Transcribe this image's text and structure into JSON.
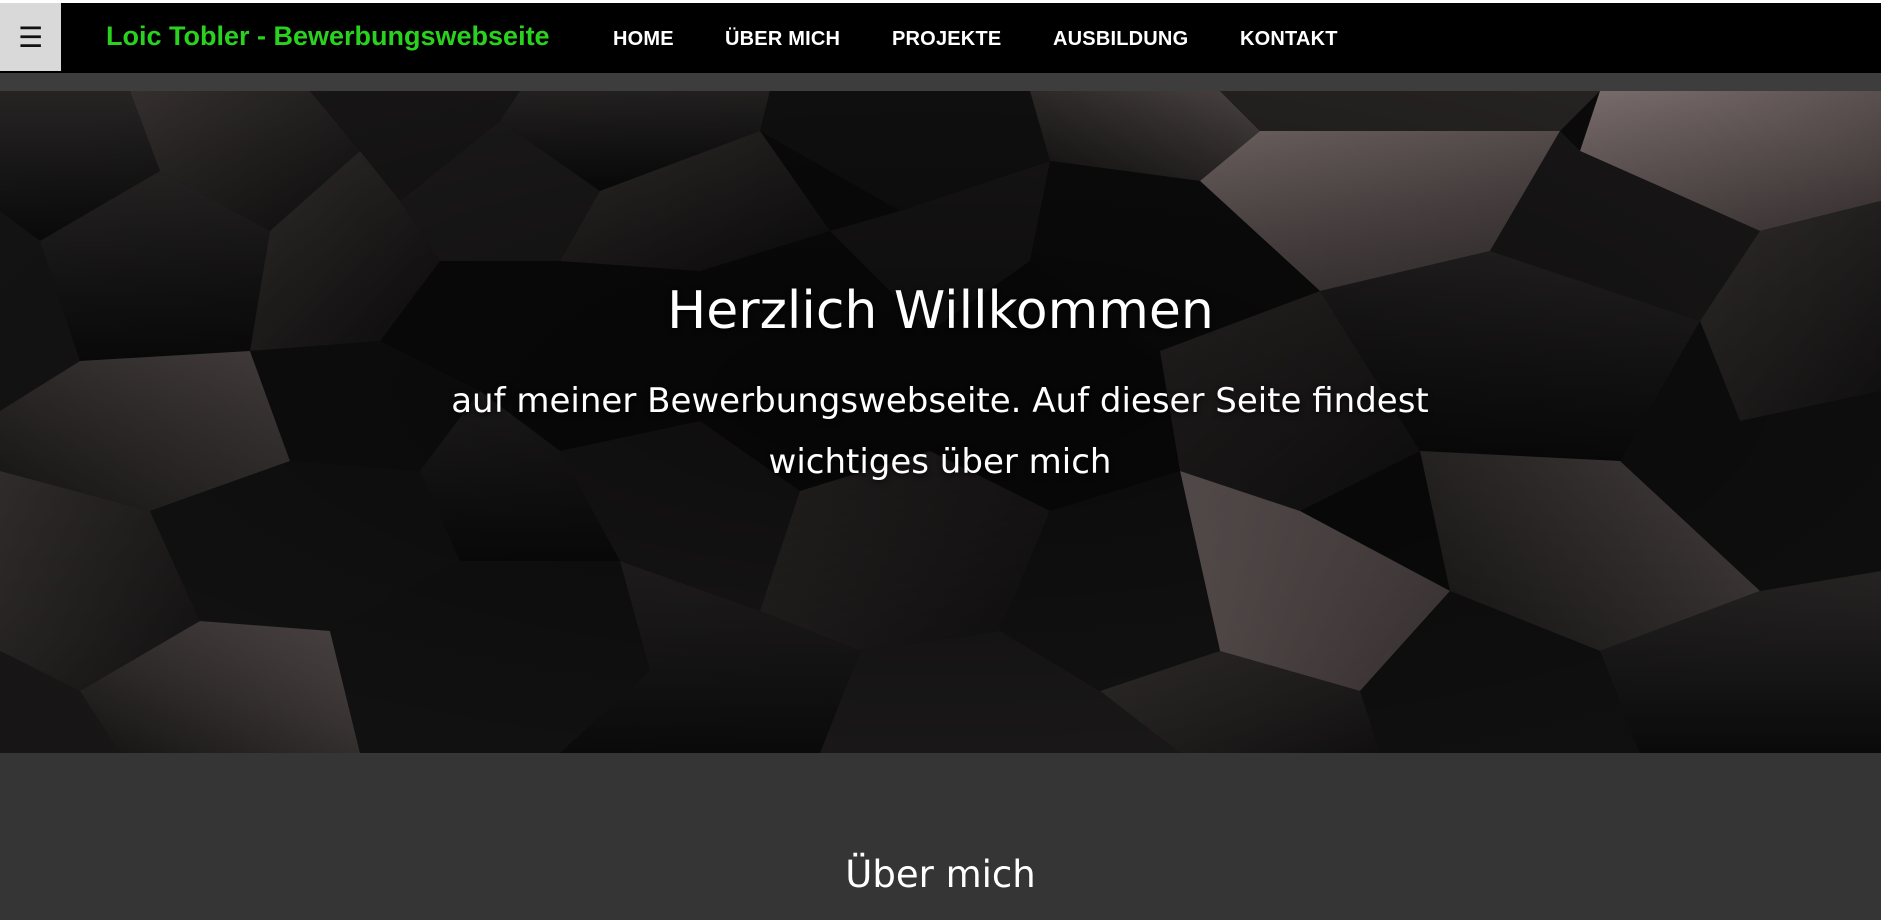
{
  "navbar": {
    "menu_icon": "hamburger-menu-icon",
    "menu_glyph": "☰",
    "brand": "Loic Tobler - Bewerbungswebseite",
    "links": [
      "HOME",
      "ÜBER MICH",
      "PROJEKTE",
      "AUSBILDUNG",
      "KONTAKT"
    ]
  },
  "hero": {
    "title": "Herzlich Willkommen",
    "subtitle": "auf meiner Bewerbungswebseite. Auf dieser Seite findest wichtiges über mich"
  },
  "about": {
    "title": "Über mich"
  },
  "colors": {
    "brand": "#2bd11f",
    "navbar_bg": "#000000",
    "section_bg": "#353535"
  }
}
